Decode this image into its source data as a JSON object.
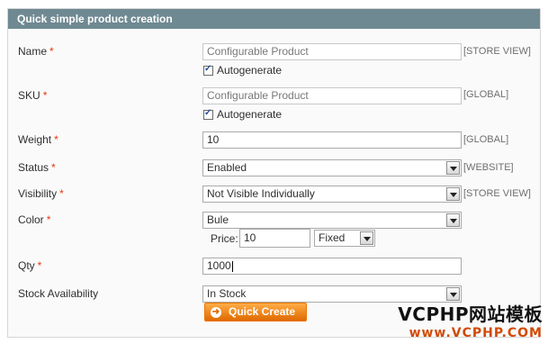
{
  "header": {
    "title": "Quick simple product creation"
  },
  "fields": {
    "name": {
      "label": "Name",
      "required": "*",
      "value": "Configurable Product",
      "autogenerate": "Autogenerate",
      "scope": "[STORE VIEW]"
    },
    "sku": {
      "label": "SKU",
      "required": "*",
      "value": "Configurable Product",
      "autogenerate": "Autogenerate",
      "scope": "[GLOBAL]"
    },
    "weight": {
      "label": "Weight",
      "required": "*",
      "value": "10",
      "scope": "[GLOBAL]"
    },
    "status": {
      "label": "Status",
      "required": "*",
      "value": "Enabled",
      "scope": "[WEBSITE]"
    },
    "visibility": {
      "label": "Visibility",
      "required": "*",
      "value": "Not Visible Individually",
      "scope": "[STORE VIEW]"
    },
    "color": {
      "label": "Color",
      "required": "*",
      "value": "Bule",
      "price_label": "Price:",
      "price_value": "10",
      "price_type": "Fixed"
    },
    "qty": {
      "label": "Qty",
      "required": "*",
      "value": "1000"
    },
    "stock": {
      "label": "Stock Availability",
      "value": "In Stock"
    }
  },
  "actions": {
    "quick_create": "Quick Create"
  },
  "watermark": {
    "line1": "VCPHP网站模板",
    "line2": "www.VCPHP.COM"
  },
  "colors": {
    "header_bg": "#6f8992",
    "required": "#eb340a",
    "button": "#df6a00"
  }
}
